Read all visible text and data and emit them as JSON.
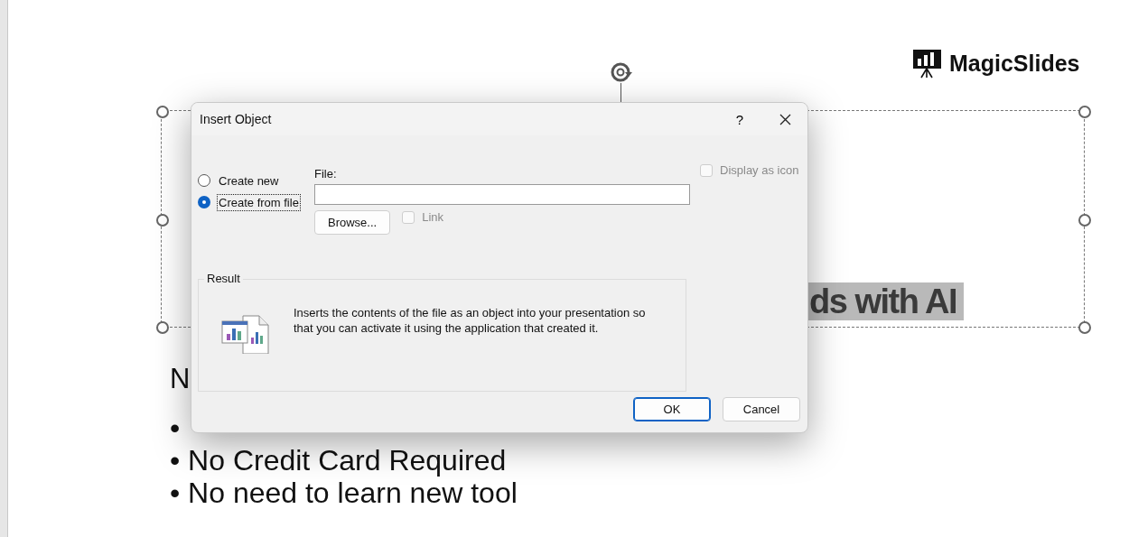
{
  "slide": {
    "selected": true,
    "logo": {
      "text": "MagicSlides"
    },
    "title": {
      "text": "ds with AI",
      "highlighted": true
    },
    "heading": "N",
    "bullets": [
      "•",
      "• No Credit Card Required",
      "• No need to learn new tool"
    ]
  },
  "dialog": {
    "title": "Insert Object",
    "help": "?",
    "options": [
      {
        "label": "Create new",
        "selected": false
      },
      {
        "label": "Create from file",
        "selected": true
      }
    ],
    "file_label": "File:",
    "browse": "Browse...",
    "link": {
      "label": "Link",
      "checked": false,
      "disabled": true
    },
    "display_as_icon": {
      "label": "Display as icon",
      "checked": false,
      "disabled": true
    },
    "result": {
      "label": "Result",
      "text": "Inserts the contents of the file as an object into your presentation so that you can activate it using the application that created it."
    },
    "buttons": [
      {
        "label": "OK",
        "default": true
      },
      {
        "label": "Cancel",
        "default": false
      }
    ]
  }
}
